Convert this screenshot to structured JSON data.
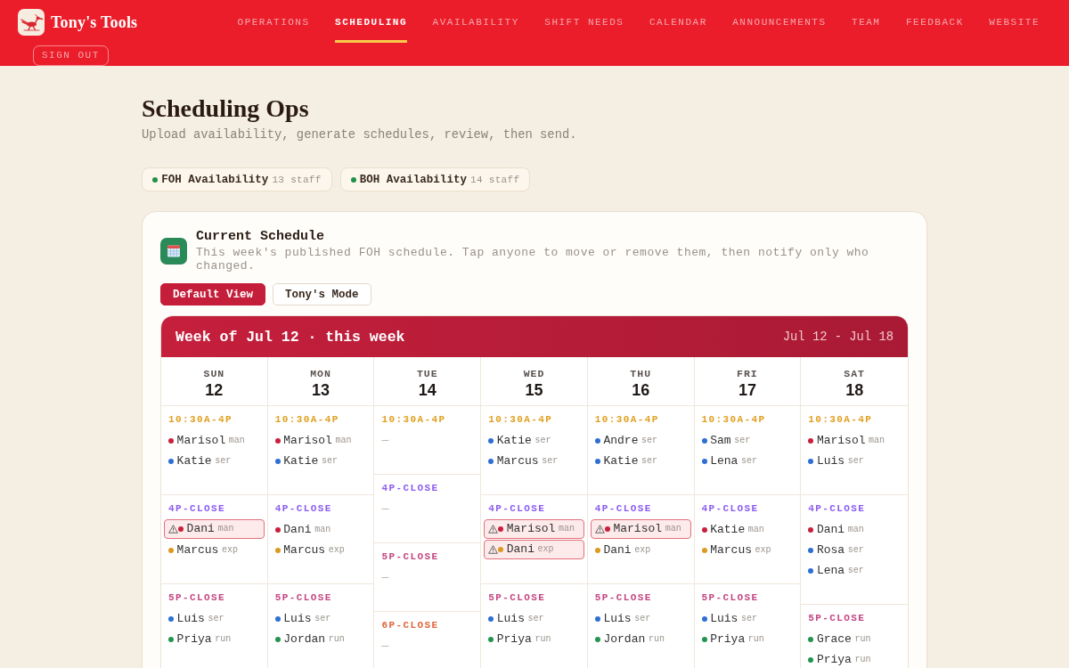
{
  "header": {
    "brand": "Tony's Tools",
    "nav": [
      {
        "label": "OPERATIONS",
        "selected": false
      },
      {
        "label": "SCHEDULING",
        "selected": true
      },
      {
        "label": "AVAILABILITY",
        "selected": false
      },
      {
        "label": "SHIFT NEEDS",
        "selected": false
      },
      {
        "label": "CALENDAR",
        "selected": false
      },
      {
        "label": "ANNOUNCEMENTS",
        "selected": false
      },
      {
        "label": "TEAM",
        "selected": false
      },
      {
        "label": "FEEDBACK",
        "selected": false
      },
      {
        "label": "WEBSITE",
        "selected": false
      }
    ],
    "sign_out": "SIGN OUT"
  },
  "page": {
    "title": "Scheduling Ops",
    "subtitle": "Upload availability, generate schedules, review, then send.",
    "availability": [
      {
        "label": "FOH Availability",
        "count": "13 staff",
        "ready": true
      },
      {
        "label": "BOH Availability",
        "count": "14 staff",
        "ready": true
      }
    ]
  },
  "schedule_card": {
    "title": "Current Schedule",
    "description": "This week's published FOH schedule. Tap anyone to move or remove them, then notify only who changed.",
    "view_modes": [
      {
        "label": "Default View",
        "selected": true
      },
      {
        "label": "Tony's Mode",
        "selected": false
      }
    ],
    "calendar": {
      "title": "Week of Jul 12 · this week",
      "range": "Jul 12 - Jul 18",
      "days": [
        {
          "day": "SUN",
          "date": "12",
          "shifts": [
            {
              "time": "10:30A-4P",
              "color": "#e0a020",
              "staff": [
                {
                  "name": "Marisol",
                  "role": "man",
                  "color": "#c8203c",
                  "conflict": false
                },
                {
                  "name": "Katie",
                  "role": "ser",
                  "color": "#2e6fd3",
                  "conflict": false
                }
              ]
            },
            {
              "time": "4P-CLOSE",
              "color": "#8b5cf0",
              "staff": [
                {
                  "name": "Dani",
                  "role": "man",
                  "color": "#c8203c",
                  "conflict": true
                },
                {
                  "name": "Marcus",
                  "role": "exp",
                  "color": "#dc9a1e",
                  "conflict": false
                }
              ]
            },
            {
              "time": "5P-CLOSE",
              "color": "#c44682",
              "staff": [
                {
                  "name": "Luis",
                  "role": "ser",
                  "color": "#2e6fd3",
                  "conflict": false
                },
                {
                  "name": "Priya",
                  "role": "run",
                  "color": "#229450",
                  "conflict": false
                }
              ]
            }
          ]
        },
        {
          "day": "MON",
          "date": "13",
          "shifts": [
            {
              "time": "10:30A-4P",
              "color": "#e0a020",
              "staff": [
                {
                  "name": "Marisol",
                  "role": "man",
                  "color": "#c8203c",
                  "conflict": false
                },
                {
                  "name": "Katie",
                  "role": "ser",
                  "color": "#2e6fd3",
                  "conflict": false
                }
              ]
            },
            {
              "time": "4P-CLOSE",
              "color": "#8b5cf0",
              "staff": [
                {
                  "name": "Dani",
                  "role": "man",
                  "color": "#c8203c",
                  "conflict": false
                },
                {
                  "name": "Marcus",
                  "role": "exp",
                  "color": "#dc9a1e",
                  "conflict": false
                }
              ]
            },
            {
              "time": "5P-CLOSE",
              "color": "#c44682",
              "staff": [
                {
                  "name": "Luis",
                  "role": "ser",
                  "color": "#2e6fd3",
                  "conflict": false
                },
                {
                  "name": "Jordan",
                  "role": "run",
                  "color": "#229450",
                  "conflict": false
                }
              ]
            }
          ]
        },
        {
          "day": "TUE",
          "date": "14",
          "shifts": [
            {
              "time": "10:30A-4P",
              "color": "#e0a020",
              "empty_text": "—"
            },
            {
              "time": "4P-CLOSE",
              "color": "#8b5cf0",
              "empty_text": "—"
            },
            {
              "time": "5P-CLOSE",
              "color": "#c44682",
              "empty_text": "—"
            },
            {
              "time": "6P-CLOSE",
              "color": "#e0663c",
              "empty_text": "—"
            }
          ]
        },
        {
          "day": "WED",
          "date": "15",
          "shifts": [
            {
              "time": "10:30A-4P",
              "color": "#e0a020",
              "staff": [
                {
                  "name": "Katie",
                  "role": "ser",
                  "color": "#2e6fd3",
                  "conflict": false
                },
                {
                  "name": "Marcus",
                  "role": "ser",
                  "color": "#2e6fd3",
                  "conflict": false
                }
              ]
            },
            {
              "time": "4P-CLOSE",
              "color": "#8b5cf0",
              "staff": [
                {
                  "name": "Marisol",
                  "role": "man",
                  "color": "#c8203c",
                  "conflict": true
                },
                {
                  "name": "Dani",
                  "role": "exp",
                  "color": "#dc9a1e",
                  "conflict": true
                }
              ]
            },
            {
              "time": "5P-CLOSE",
              "color": "#c44682",
              "staff": [
                {
                  "name": "Luis",
                  "role": "ser",
                  "color": "#2e6fd3",
                  "conflict": false
                },
                {
                  "name": "Priya",
                  "role": "run",
                  "color": "#229450",
                  "conflict": false
                }
              ]
            }
          ]
        },
        {
          "day": "THU",
          "date": "16",
          "shifts": [
            {
              "time": "10:30A-4P",
              "color": "#e0a020",
              "staff": [
                {
                  "name": "Andre",
                  "role": "ser",
                  "color": "#2e6fd3",
                  "conflict": false
                },
                {
                  "name": "Katie",
                  "role": "ser",
                  "color": "#2e6fd3",
                  "conflict": false
                }
              ]
            },
            {
              "time": "4P-CLOSE",
              "color": "#8b5cf0",
              "staff": [
                {
                  "name": "Marisol",
                  "role": "man",
                  "color": "#c8203c",
                  "conflict": true
                },
                {
                  "name": "Dani",
                  "role": "exp",
                  "color": "#dc9a1e",
                  "conflict": false
                }
              ]
            },
            {
              "time": "5P-CLOSE",
              "color": "#c44682",
              "staff": [
                {
                  "name": "Luis",
                  "role": "ser",
                  "color": "#2e6fd3",
                  "conflict": false
                },
                {
                  "name": "Jordan",
                  "role": "run",
                  "color": "#229450",
                  "conflict": false
                }
              ]
            }
          ]
        },
        {
          "day": "FRI",
          "date": "17",
          "shifts": [
            {
              "time": "10:30A-4P",
              "color": "#e0a020",
              "staff": [
                {
                  "name": "Sam",
                  "role": "ser",
                  "color": "#2e6fd3",
                  "conflict": false
                },
                {
                  "name": "Lena",
                  "role": "ser",
                  "color": "#2e6fd3",
                  "conflict": false
                }
              ]
            },
            {
              "time": "4P-CLOSE",
              "color": "#8b5cf0",
              "staff": [
                {
                  "name": "Katie",
                  "role": "man",
                  "color": "#c8203c",
                  "conflict": false
                },
                {
                  "name": "Marcus",
                  "role": "exp",
                  "color": "#dc9a1e",
                  "conflict": false
                }
              ]
            },
            {
              "time": "5P-CLOSE",
              "color": "#c44682",
              "staff": [
                {
                  "name": "Luis",
                  "role": "ser",
                  "color": "#2e6fd3",
                  "conflict": false
                },
                {
                  "name": "Priya",
                  "role": "run",
                  "color": "#229450",
                  "conflict": false
                }
              ]
            }
          ]
        },
        {
          "day": "SAT",
          "date": "18",
          "shifts": [
            {
              "time": "10:30A-4P",
              "color": "#e0a020",
              "staff": [
                {
                  "name": "Marisol",
                  "role": "man",
                  "color": "#c8203c",
                  "conflict": false
                },
                {
                  "name": "Luis",
                  "role": "ser",
                  "color": "#2e6fd3",
                  "conflict": false
                }
              ]
            },
            {
              "time": "4P-CLOSE",
              "color": "#8b5cf0",
              "staff": [
                {
                  "name": "Dani",
                  "role": "man",
                  "color": "#c8203c",
                  "conflict": false
                },
                {
                  "name": "Rosa",
                  "role": "ser",
                  "color": "#2e6fd3",
                  "conflict": false
                },
                {
                  "name": "Lena",
                  "role": "ser",
                  "color": "#2e6fd3",
                  "conflict": false
                }
              ]
            },
            {
              "time": "5P-CLOSE",
              "color": "#c44682",
              "staff": [
                {
                  "name": "Grace",
                  "role": "run",
                  "color": "#229450",
                  "conflict": false
                },
                {
                  "name": "Priya",
                  "role": "run",
                  "color": "#229450",
                  "conflict": false
                }
              ]
            }
          ]
        }
      ]
    }
  }
}
